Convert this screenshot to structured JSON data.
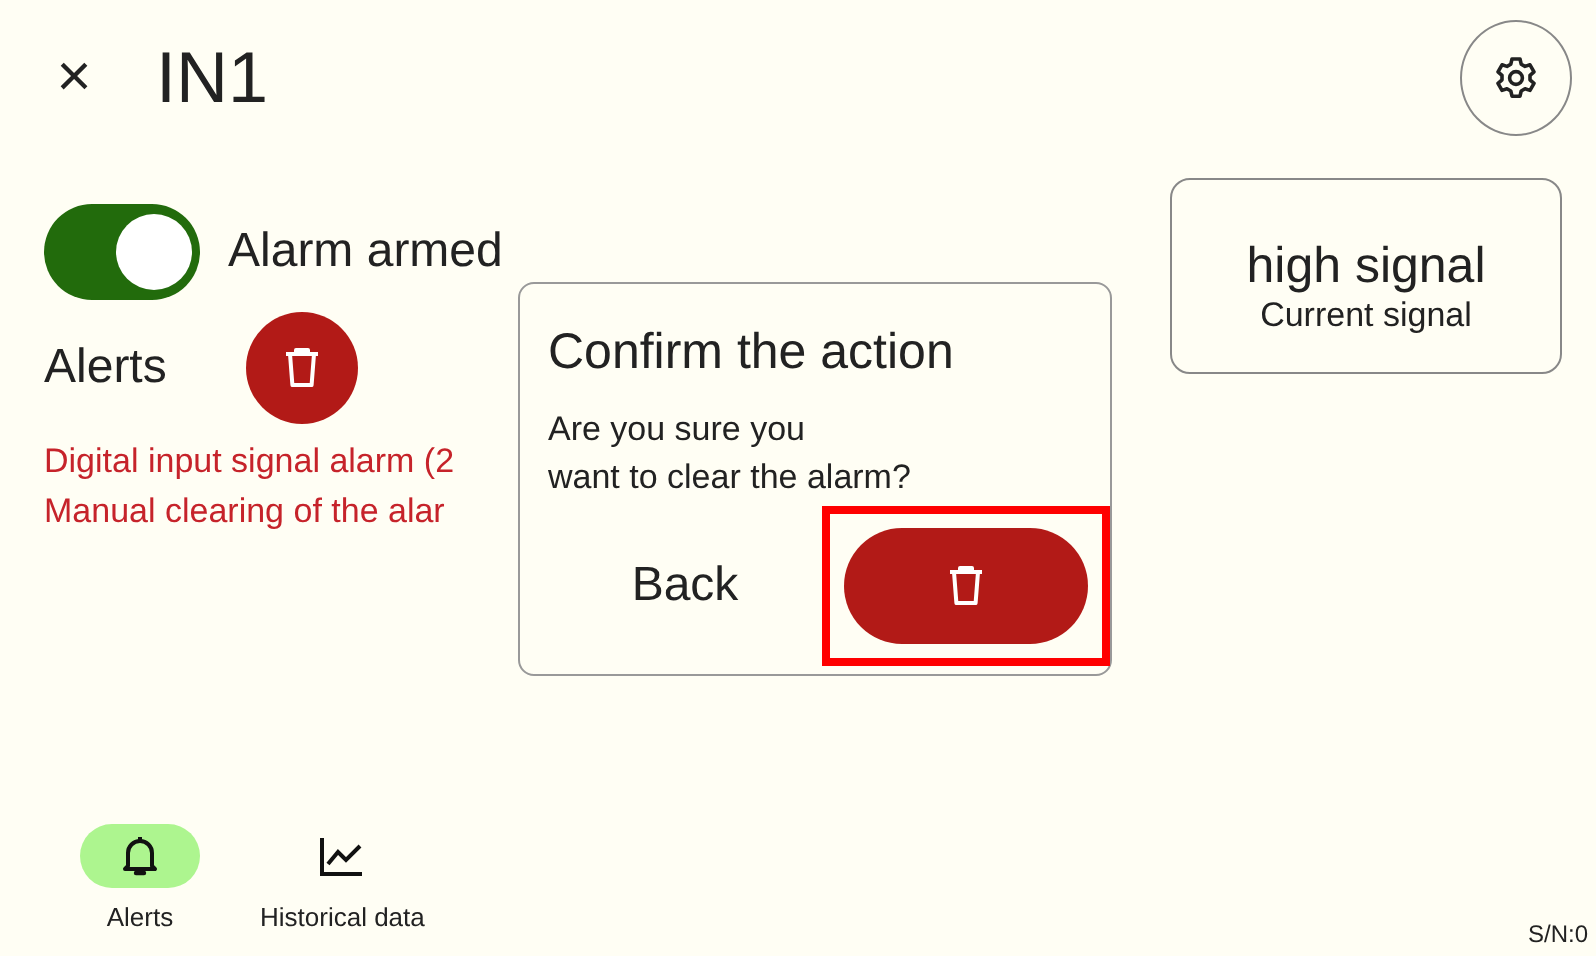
{
  "header": {
    "close": "×",
    "title": "IN1"
  },
  "alarm_toggle": {
    "label": "Alarm armed",
    "on": true
  },
  "alerts": {
    "label": "Alerts",
    "messages": [
      "Digital input signal alarm (2",
      "Manual clearing of the alar"
    ]
  },
  "signal_card": {
    "value": "high signal",
    "caption": "Current signal"
  },
  "dialog": {
    "title": "Confirm the action",
    "message": "Are you sure you\nwant to clear the alarm?",
    "back": "Back",
    "confirm_highlighted": true
  },
  "nav": [
    {
      "label": "Alerts",
      "kind": "bell",
      "selected": true
    },
    {
      "label": "Historical data",
      "kind": "chart",
      "selected": false
    }
  ],
  "serial": "S/N:0"
}
